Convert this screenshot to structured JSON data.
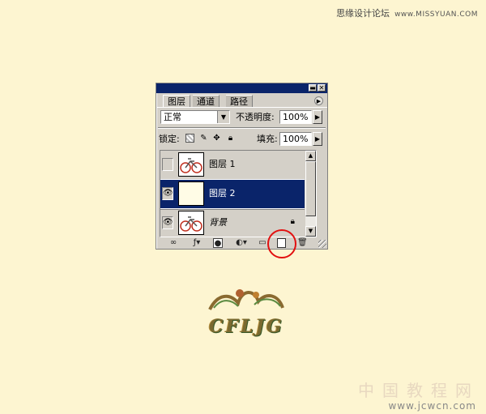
{
  "watermark": {
    "site": "思缘设计论坛",
    "url": "www.MISSYUAN.COM",
    "bottom_cn": "中国教程网",
    "bottom_url": "www.jcwcn.com"
  },
  "palette": {
    "tabs": [
      {
        "label": "图层",
        "active": true
      },
      {
        "label": "通道",
        "active": false
      },
      {
        "label": "路径",
        "active": false
      }
    ],
    "blend_mode": "正常",
    "opacity_label": "不透明度:",
    "opacity_value": "100%",
    "lock_label": "锁定:",
    "fill_label": "填充:",
    "fill_value": "100%",
    "layers": [
      {
        "name": "图层 1",
        "visible": false,
        "selected": false,
        "thumb": "bike"
      },
      {
        "name": "图层 2",
        "visible": true,
        "selected": true,
        "thumb": "plain"
      },
      {
        "name": "背景",
        "visible": true,
        "selected": false,
        "thumb": "bike",
        "locked": true
      }
    ]
  },
  "logo": {
    "text": "CFLJG"
  },
  "colors": {
    "background": "#fdf5d1",
    "titlebar": "#0a246a",
    "selected_layer": "#0a246a",
    "highlight": "#e21010"
  }
}
